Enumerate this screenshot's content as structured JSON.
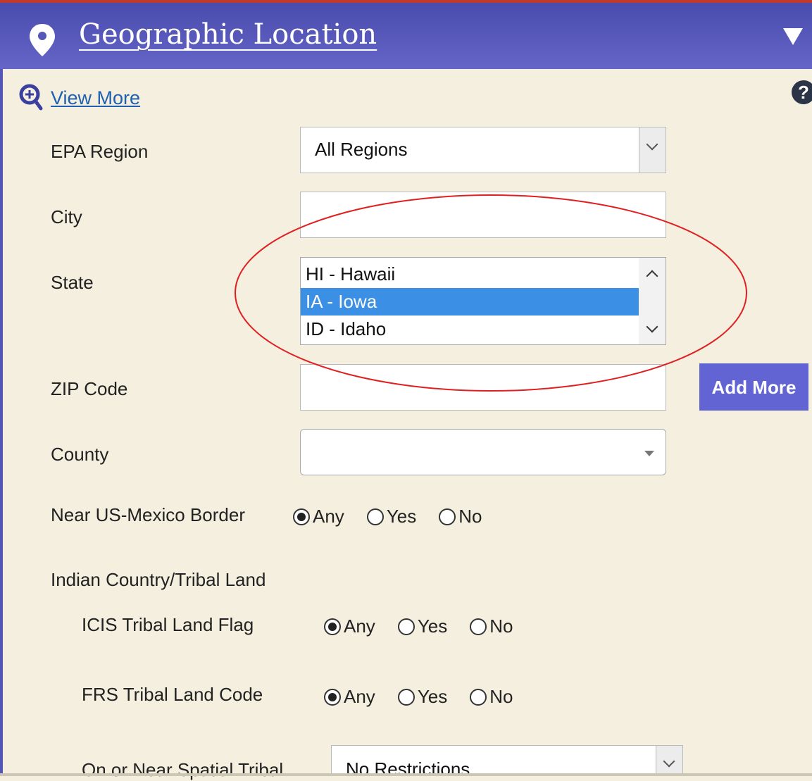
{
  "header": {
    "title": "Geographic Location",
    "icon": "map-pin-icon",
    "toggle_icon": "triangle-down-icon"
  },
  "colors": {
    "header": "#5557b8",
    "panel_bg": "#f4efde",
    "selected_option": "#3b8fe5",
    "add_button": "#6264d4",
    "annotation": "#e02020"
  },
  "view_more": {
    "label": "View More",
    "icon": "zoom-in-icon"
  },
  "help": {
    "glyph": "?",
    "icon": "help-icon"
  },
  "fields": {
    "epa_region": {
      "label": "EPA Region",
      "value": "All Regions"
    },
    "city": {
      "label": "City",
      "value": ""
    },
    "state": {
      "label": "State",
      "options": [
        "HI - Hawaii",
        "IA - Iowa",
        "ID - Idaho"
      ],
      "selected": "IA - Iowa"
    },
    "zip": {
      "label": "ZIP Code",
      "value": "",
      "add_button": "Add More"
    },
    "county": {
      "label": "County",
      "value": ""
    },
    "border": {
      "label": "Near US-Mexico Border",
      "options": [
        "Any",
        "Yes",
        "No"
      ],
      "selected": "Any"
    },
    "tribal": {
      "label": "Indian Country/Tribal Land"
    },
    "icis_tribal": {
      "label": "ICIS Tribal Land Flag",
      "options": [
        "Any",
        "Yes",
        "No"
      ],
      "selected": "Any"
    },
    "frs_tribal": {
      "label": "FRS Tribal Land Code",
      "options": [
        "Any",
        "Yes",
        "No"
      ],
      "selected": "Any"
    },
    "spatial_tribal": {
      "label": "On or Near Spatial Tribal",
      "value": "No Restrictions"
    }
  }
}
